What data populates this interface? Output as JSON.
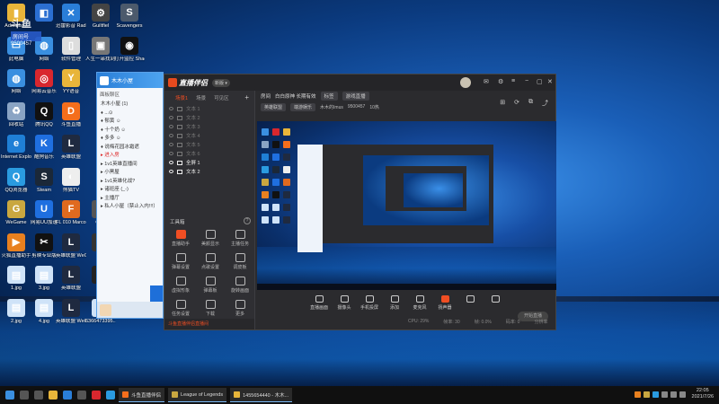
{
  "watermark": {
    "top": "斗鱼",
    "room_label": "房间号",
    "room_number": "9500457"
  },
  "desktop_icons": [
    {
      "label": "Administ...",
      "color": "#e8b53a",
      "glyph": "▮",
      "col": 0,
      "row": 0
    },
    {
      "label": "",
      "color": "#2b6fd1",
      "glyph": "◧",
      "col": 1,
      "row": 0
    },
    {
      "label": "迅雷影音 Radio",
      "color": "#2a7ed8",
      "glyph": "✕",
      "col": 2,
      "row": 0
    },
    {
      "label": "Guiltfiel",
      "color": "#444",
      "glyph": "⚙",
      "col": 3,
      "row": 0
    },
    {
      "label": "Scavengers",
      "color": "#4c5a6c",
      "glyph": "S",
      "col": 4,
      "row": 0
    },
    {
      "label": "此电脑",
      "color": "#3a8fe0",
      "glyph": "▭",
      "col": 0,
      "row": 1
    },
    {
      "label": "网络",
      "color": "#3a8fe0",
      "glyph": "◍",
      "col": 1,
      "row": 1
    },
    {
      "label": "软件管理",
      "color": "#ddd",
      "glyph": "▯",
      "col": 2,
      "row": 1
    },
    {
      "label": "人生一串找到 Rocket Tw...",
      "color": "#777",
      "glyph": "▣",
      "col": 3,
      "row": 1
    },
    {
      "label": "打开监控 Shadowing...",
      "color": "#111",
      "glyph": "◉",
      "col": 4,
      "row": 1
    },
    {
      "label": "网络",
      "color": "#3a8fe0",
      "glyph": "◍",
      "col": 0,
      "row": 2
    },
    {
      "label": "网易云音乐",
      "color": "#d9272e",
      "glyph": "◎",
      "col": 1,
      "row": 2
    },
    {
      "label": "YY语音",
      "color": "#e8b53a",
      "glyph": "Y",
      "col": 2,
      "row": 2
    },
    {
      "label": "回收站",
      "color": "#8aa4c4",
      "glyph": "♻",
      "col": 0,
      "row": 3
    },
    {
      "label": "腾讯QQ",
      "color": "#111",
      "glyph": "Q",
      "col": 1,
      "row": 3
    },
    {
      "label": "斗鱼直播",
      "color": "#f46e1c",
      "glyph": "D",
      "col": 2,
      "row": 3
    },
    {
      "label": "Internet Explorer",
      "color": "#1f7fd6",
      "glyph": "e",
      "col": 0,
      "row": 4
    },
    {
      "label": "酷狗音乐",
      "color": "#1f6fe0",
      "glyph": "K",
      "col": 1,
      "row": 4
    },
    {
      "label": "英雄联盟",
      "color": "#1f2a40",
      "glyph": "L",
      "col": 2,
      "row": 4
    },
    {
      "label": "QQ浏览器",
      "color": "#2a9be0",
      "glyph": "Q",
      "col": 0,
      "row": 5
    },
    {
      "label": "Steam",
      "color": "#1b2838",
      "glyph": "S",
      "col": 1,
      "row": 5
    },
    {
      "label": "熊猫TV",
      "color": "#eee",
      "glyph": "◐",
      "col": 2,
      "row": 5
    },
    {
      "label": "WeGame",
      "color": "#c9a740",
      "glyph": "G",
      "col": 0,
      "row": 6
    },
    {
      "label": "网易UU加速",
      "color": "#1f6fe0",
      "glyph": "U",
      "col": 1,
      "row": 6
    },
    {
      "label": "FL 010 Marco Roma",
      "color": "#e06a1f",
      "glyph": "F",
      "col": 2,
      "row": 6
    },
    {
      "label": "CPU",
      "color": "#555",
      "glyph": "▦",
      "col": 3,
      "row": 6
    },
    {
      "label": "火狐直播助手",
      "color": "#e8801f",
      "glyph": "▶",
      "col": 0,
      "row": 7
    },
    {
      "label": "剪映专业版",
      "color": "#111",
      "glyph": "✂",
      "col": 1,
      "row": 7
    },
    {
      "label": "英雄联盟 WeGame版",
      "color": "#1f2a40",
      "glyph": "L",
      "col": 2,
      "row": 7
    },
    {
      "label": "PU",
      "color": "#333",
      "glyph": "P",
      "col": 3,
      "row": 7
    },
    {
      "label": "1.jpg",
      "color": "#cfe3f8",
      "glyph": "▤",
      "col": 0,
      "row": 8
    },
    {
      "label": "3.jpg",
      "color": "#cfe3f8",
      "glyph": "▤",
      "col": 1,
      "row": 8
    },
    {
      "label": "英雄联盟",
      "color": "#1f2a40",
      "glyph": "L",
      "col": 2,
      "row": 8
    },
    {
      "label": "epic",
      "color": "#222",
      "glyph": "E",
      "col": 3,
      "row": 8
    },
    {
      "label": "2.jpg",
      "color": "#cfe3f8",
      "glyph": "▤",
      "col": 0,
      "row": 9
    },
    {
      "label": "4.jpg",
      "color": "#cfe3f8",
      "glyph": "▤",
      "col": 1,
      "row": 9
    },
    {
      "label": "英雄联盟 WeGame版",
      "color": "#1f2a40",
      "glyph": "L",
      "col": 2,
      "row": 9
    },
    {
      "label": "6366473395...",
      "color": "#cfe3f8",
      "glyph": "▤",
      "col": 3,
      "row": 9
    }
  ],
  "chat": {
    "header": "木木小屋",
    "title": "面板聊区",
    "items": [
      {
        "text": "木木小屋 (1)",
        "red": false
      },
      {
        "text": "♦ ...⊙",
        "red": false
      },
      {
        "text": "♦ 郁黄 ☺",
        "red": false
      },
      {
        "text": "♦ 十个奶 ☺",
        "red": false
      },
      {
        "text": "♦ 多多 ☺",
        "red": false
      },
      {
        "text": "♦ 说梅花园冰霜遮",
        "red": false
      },
      {
        "text": "▸ 进入房",
        "red": true
      },
      {
        "text": "▸ 1v1英雄直播间",
        "red": false
      },
      {
        "text": "▸ 小黑屋",
        "red": false
      },
      {
        "text": "▸ 1v1英雄化战?",
        "red": false
      },
      {
        "text": "▸ 诸班座 (_-)",
        "red": false
      },
      {
        "text": "▸ 主播厅",
        "red": false
      },
      {
        "text": "▸ 私人小屋（禁止入内!!!）",
        "red": false
      }
    ]
  },
  "app": {
    "name": "直播伴侣",
    "badge": "新版 ▾",
    "side_tabs": {
      "scene": "场景1",
      "add": "场景",
      "third": "可见区",
      "plus": "+"
    },
    "sources": [
      {
        "name": "文本 1",
        "on": false
      },
      {
        "name": "文本 2",
        "on": false
      },
      {
        "name": "文本 3",
        "on": false
      },
      {
        "name": "文本 4",
        "on": false
      },
      {
        "name": "文本 5",
        "on": false
      },
      {
        "name": "文本 6",
        "on": false
      },
      {
        "name": "全屏 1",
        "on": true
      },
      {
        "name": "文本 2",
        "on": true
      }
    ],
    "tools_label": "工具箱",
    "tools_help": "?",
    "tools": [
      {
        "label": "直播助手",
        "red": true
      },
      {
        "label": "美颜显示",
        "red": false
      },
      {
        "label": "主播任务",
        "red": false
      },
      {
        "label": "弹幕设置",
        "red": false
      },
      {
        "label": "点歌设置",
        "red": false
      },
      {
        "label": "调皮板",
        "red": false
      },
      {
        "label": "虚拟形象",
        "red": false
      },
      {
        "label": "弹幕板",
        "red": false
      },
      {
        "label": "旋转画面",
        "red": false
      },
      {
        "label": "任务设置",
        "red": false
      },
      {
        "label": "下载",
        "red": false
      },
      {
        "label": "更多",
        "red": false
      }
    ],
    "footer": "斗鱼直播伴侣直播间",
    "room": {
      "label": "房间",
      "title": "白白原神 长期有效",
      "tag": "标签",
      "category": "游戏直播",
      "game_label": "英雄联盟",
      "game_sub": "端游娱乐",
      "host": "木木的Imus",
      "room_id": "9500457",
      "viewers": "10热"
    },
    "controls": [
      {
        "label": "直播画面",
        "red": false
      },
      {
        "label": "摄像头",
        "red": false
      },
      {
        "label": "手机投屏",
        "red": false
      },
      {
        "label": "添加",
        "red": false
      },
      {
        "label": "麦克风",
        "red": false
      },
      {
        "label": "扬声器",
        "red": true
      },
      {
        "label": "",
        "red": false
      },
      {
        "label": "",
        "red": false
      }
    ],
    "start_live": "开始直播",
    "stats": [
      "CPU: 29%",
      "帧率: 30",
      "帧: 0.0%",
      "码率: 0",
      "分辨率"
    ]
  },
  "taskbar": {
    "buttons": [
      {
        "label": "斗鱼直播伴侣",
        "color": "#f46e1c"
      },
      {
        "label": "League of Legends",
        "color": "#c9a740"
      },
      {
        "label": "1455654440 - 木木...",
        "color": "#e8b53a"
      }
    ],
    "time": "22:05",
    "date": "2021/7/26"
  }
}
